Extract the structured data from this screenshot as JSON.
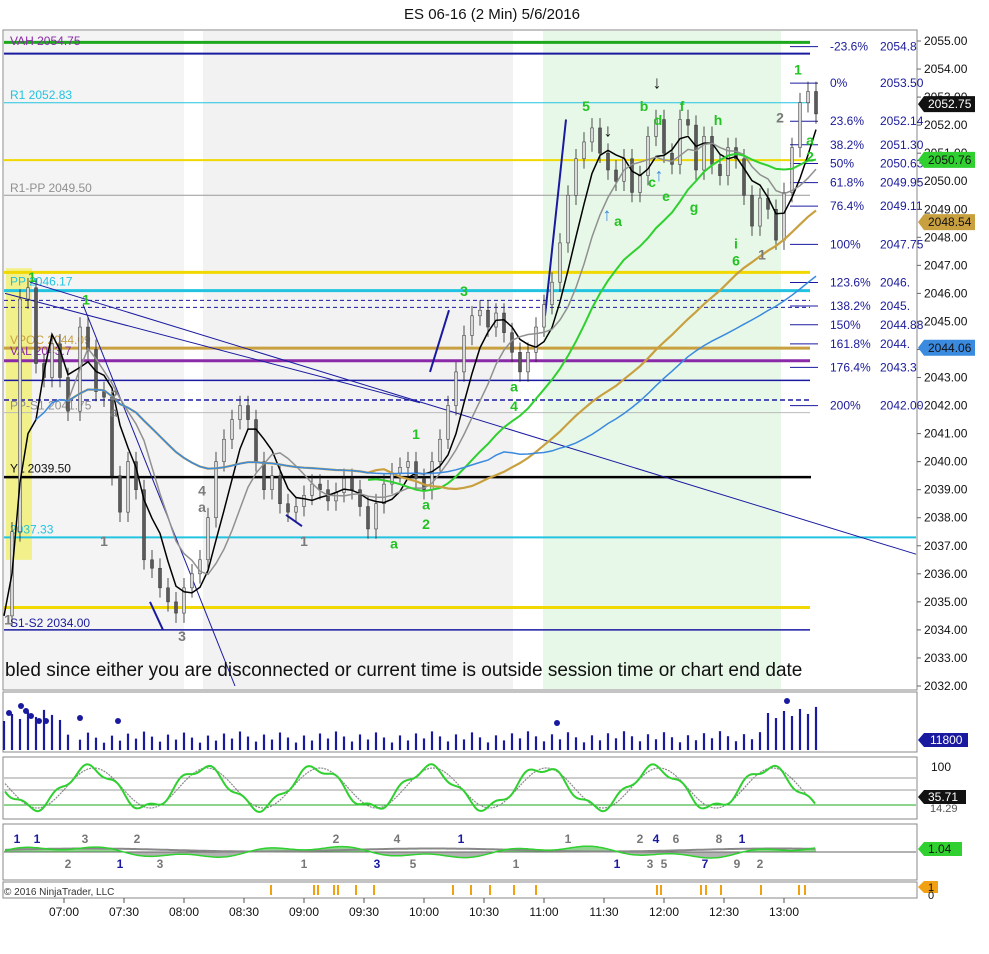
{
  "title": "ES 06-16 (2 Min)  5/6/2016",
  "copyright": "© 2016 NinjaTrader, LLC",
  "warning": "bled since either you are disconnected or current time is outside session time or chart end date",
  "colors": {
    "bar": "#5a5a5a",
    "wick": "#222222",
    "label_green": "#22c322",
    "label_gray": "#7a7a7a",
    "fib_blue": "#1a1a9a",
    "pivot_cyan": "#22c3e0",
    "pivot_yellow": "#f0d800",
    "purple": "#8a2aa8",
    "navy": "#1a1aa0",
    "ma_green": "#30d030",
    "ma_blue": "#3a8adf",
    "ma_gold": "#c8a040",
    "ma_gray": "#909090",
    "black": "#000000"
  },
  "chart_data": {
    "type": "candlestick",
    "title": "ES 06-16 (2 Min)  5/6/2016",
    "ylim": [
      2032.0,
      2055.0
    ],
    "y_ticks": [
      "2055.00",
      "2054.00",
      "2053.00",
      "2052.00",
      "2051.00",
      "2050.00",
      "2049.00",
      "2048.00",
      "2047.00",
      "2046.00",
      "2045.00",
      "2044.00",
      "2043.00",
      "2042.00",
      "2041.00",
      "2040.00",
      "2039.00",
      "2038.00",
      "2037.00",
      "2036.00",
      "2035.00",
      "2034.00",
      "2033.00",
      "2032.00"
    ],
    "x_ticks": [
      "07:00",
      "07:30",
      "08:00",
      "08:30",
      "09:00",
      "09:30",
      "10:00",
      "10:30",
      "11:00",
      "11:30",
      "12:00",
      "12:30",
      "13:00"
    ],
    "x_start": "06:30",
    "x_end": "13:16",
    "price_markers": [
      {
        "value": 2052.75,
        "label": "2052.75",
        "color": "#111111"
      },
      {
        "value": 2050.76,
        "label": "2050.76",
        "color": "#30d030"
      },
      {
        "value": 2048.54,
        "label": "2048.54",
        "color": "#c8a040"
      },
      {
        "value": 2044.06,
        "label": "2044.06",
        "color": "#3a8adf"
      }
    ],
    "levels": [
      {
        "label": "VAH 2054.75",
        "value": 2054.75,
        "color": "#8a2aa8"
      },
      {
        "label": "R1 2052.83",
        "value": 2052.83,
        "color": "#22c3e0"
      },
      {
        "label": "R1-PP 2049.50",
        "value": 2049.5,
        "color": "#909090"
      },
      {
        "label": "PP 2046.17",
        "value": 2046.17,
        "color": "#22c3e0"
      },
      {
        "label": "VAL 2043.7",
        "value": 2043.7,
        "color": "#8a2aa8"
      },
      {
        "label": "VPOC 2044.09",
        "value": 2044.09,
        "color": "#c8a040"
      },
      {
        "label": "PP-S1 2041.75",
        "value": 2041.75,
        "color": "#909090"
      },
      {
        "label": "YL 2039.50",
        "value": 2039.5,
        "color": "#000000"
      },
      {
        "label": "2037.33",
        "value": 2037.33,
        "color": "#22c3e0"
      },
      {
        "label": "S1-S2 2034.00",
        "value": 2034.0,
        "color": "#1a1aa0"
      }
    ],
    "fib_levels": [
      {
        "label": "-23.6%",
        "value": 2054.8,
        "text": "2054.8"
      },
      {
        "label": "0%",
        "value": 2053.5,
        "text": "2053.50"
      },
      {
        "label": "23.6%",
        "value": 2052.14,
        "text": "2052.14"
      },
      {
        "label": "38.2%",
        "value": 2051.3,
        "text": "2051.30"
      },
      {
        "label": "50%",
        "value": 2050.63,
        "text": "2050.63"
      },
      {
        "label": "61.8%",
        "value": 2049.95,
        "text": "2049.95"
      },
      {
        "label": "76.4%",
        "value": 2049.11,
        "text": "2049.11"
      },
      {
        "label": "100%",
        "value": 2047.75,
        "text": "2047.75"
      },
      {
        "label": "123.6%",
        "value": 2046.39,
        "text": "2046."
      },
      {
        "label": "138.2%",
        "value": 2045.55,
        "text": "2045."
      },
      {
        "label": "150%",
        "value": 2044.88,
        "text": "2044.88"
      },
      {
        "label": "161.8%",
        "value": 2044.2,
        "text": "2044."
      },
      {
        "label": "176.4%",
        "value": 2043.36,
        "text": "2043.3"
      },
      {
        "label": "200%",
        "value": 2042.0,
        "text": "2042.00"
      }
    ],
    "wave_labels": [
      {
        "t": "06:32",
        "p": 2034.2,
        "text": "1",
        "color": "gray"
      },
      {
        "t": "06:44",
        "p": 2046.4,
        "text": "1",
        "color": "green"
      },
      {
        "t": "07:11",
        "p": 2045.6,
        "text": "1",
        "color": "green"
      },
      {
        "t": "07:25",
        "p": 2042.2,
        "text": "2",
        "color": "gray"
      },
      {
        "t": "07:25",
        "p": 2041.6,
        "text": "a",
        "color": "gray"
      },
      {
        "t": "07:20",
        "p": 2037.0,
        "text": "1",
        "color": "gray"
      },
      {
        "t": "07:59",
        "p": 2033.6,
        "text": "3",
        "color": "gray"
      },
      {
        "t": "08:09",
        "p": 2038.8,
        "text": "4",
        "color": "gray"
      },
      {
        "t": "08:09",
        "p": 2038.2,
        "text": "a",
        "color": "gray"
      },
      {
        "t": "09:00",
        "p": 2037.0,
        "text": "1",
        "color": "gray"
      },
      {
        "t": "09:45",
        "p": 2036.9,
        "text": "a",
        "color": "green"
      },
      {
        "t": "09:56",
        "p": 2040.8,
        "text": "1",
        "color": "green"
      },
      {
        "t": "10:01",
        "p": 2038.3,
        "text": "a",
        "color": "green"
      },
      {
        "t": "10:01",
        "p": 2037.6,
        "text": "2",
        "color": "green"
      },
      {
        "t": "10:20",
        "p": 2045.9,
        "text": "3",
        "color": "green"
      },
      {
        "t": "10:45",
        "p": 2042.5,
        "text": "a",
        "color": "green"
      },
      {
        "t": "10:45",
        "p": 2041.8,
        "text": "4",
        "color": "green"
      },
      {
        "t": "11:21",
        "p": 2052.5,
        "text": "5",
        "color": "green"
      },
      {
        "t": "11:37",
        "p": 2048.4,
        "text": "a",
        "color": "green"
      },
      {
        "t": "11:50",
        "p": 2052.5,
        "text": "b",
        "color": "green"
      },
      {
        "t": "11:54",
        "p": 2049.8,
        "text": "c",
        "color": "green"
      },
      {
        "t": "11:57",
        "p": 2052.0,
        "text": "d",
        "color": "green"
      },
      {
        "t": "12:01",
        "p": 2049.3,
        "text": "e",
        "color": "green"
      },
      {
        "t": "12:09",
        "p": 2052.5,
        "text": "f",
        "color": "green"
      },
      {
        "t": "12:15",
        "p": 2048.9,
        "text": "g",
        "color": "green"
      },
      {
        "t": "12:27",
        "p": 2052.0,
        "text": "h",
        "color": "green"
      },
      {
        "t": "12:36",
        "p": 2047.6,
        "text": "i",
        "color": "green"
      },
      {
        "t": "12:36",
        "p": 2047.0,
        "text": "6",
        "color": "green"
      },
      {
        "t": "12:49",
        "p": 2047.2,
        "text": "1",
        "color": "gray"
      },
      {
        "t": "12:58",
        "p": 2052.1,
        "text": "2",
        "color": "gray"
      },
      {
        "t": "13:07",
        "p": 2053.8,
        "text": "1",
        "color": "green"
      },
      {
        "t": "13:13",
        "p": 2051.3,
        "text": "a",
        "color": "green"
      },
      {
        "t": "13:13",
        "p": 2050.7,
        "text": "2",
        "color": "green"
      }
    ],
    "volume": {
      "label": "11800",
      "max": 24000
    },
    "stochastic": {
      "label_top": "100",
      "value_label": "35.71",
      "value2_label": "14.29",
      "label_bottom": "0"
    },
    "macd": {
      "value_label": "1.04",
      "labels": [
        "1",
        "2",
        "3",
        "1",
        "2",
        "3",
        "1",
        "1",
        "2",
        "3",
        "4",
        "5",
        "1",
        "1",
        "1",
        "1",
        "2",
        "3",
        "4",
        "5",
        "6",
        "7",
        "8",
        "9",
        "1",
        "2"
      ]
    },
    "bottom_panel": {
      "value_label": "1",
      "label_top": "1",
      "label_bottom": "0"
    }
  }
}
